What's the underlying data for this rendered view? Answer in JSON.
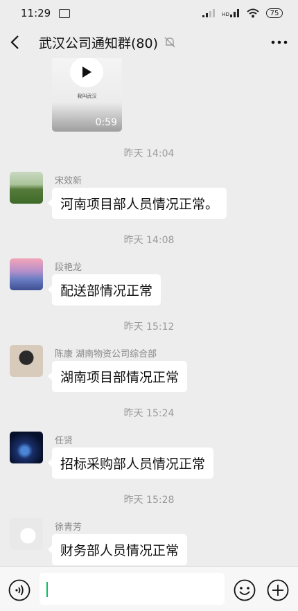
{
  "status": {
    "time": "11:29",
    "hd": "HD",
    "battery": "75"
  },
  "header": {
    "title": "武汉公司通知群(80)"
  },
  "messages": [
    {
      "type": "video",
      "caption": "我叫武汉",
      "duration": "0:59"
    },
    {
      "type": "time",
      "text": "昨天 14:04"
    },
    {
      "type": "text",
      "sender": "宋效新",
      "text": "河南项目部人员情况正常。"
    },
    {
      "type": "time",
      "text": "昨天 14:08"
    },
    {
      "type": "text",
      "sender": "段艳龙",
      "text": "配送部情况正常"
    },
    {
      "type": "time",
      "text": "昨天 15:12"
    },
    {
      "type": "text",
      "sender": "陈康 湖南物资公司综合部",
      "text": "湖南项目部情况正常"
    },
    {
      "type": "time",
      "text": "昨天 15:24"
    },
    {
      "type": "text",
      "sender": "任贤",
      "text": "招标采购部人员情况正常"
    },
    {
      "type": "time",
      "text": "昨天 15:28"
    },
    {
      "type": "text",
      "sender": "徐青芳",
      "text": "财务部人员情况正常"
    }
  ],
  "input": {
    "value": "",
    "placeholder": ""
  },
  "colors": {
    "background": "#ededed",
    "bubble": "#ffffff",
    "caret": "#07c160",
    "timestamp": "#999999"
  },
  "icons": [
    "back-arrow-icon",
    "mute-bell-icon",
    "more-dots-icon",
    "play-icon",
    "voice-icon",
    "emoji-icon",
    "plus-icon"
  ]
}
